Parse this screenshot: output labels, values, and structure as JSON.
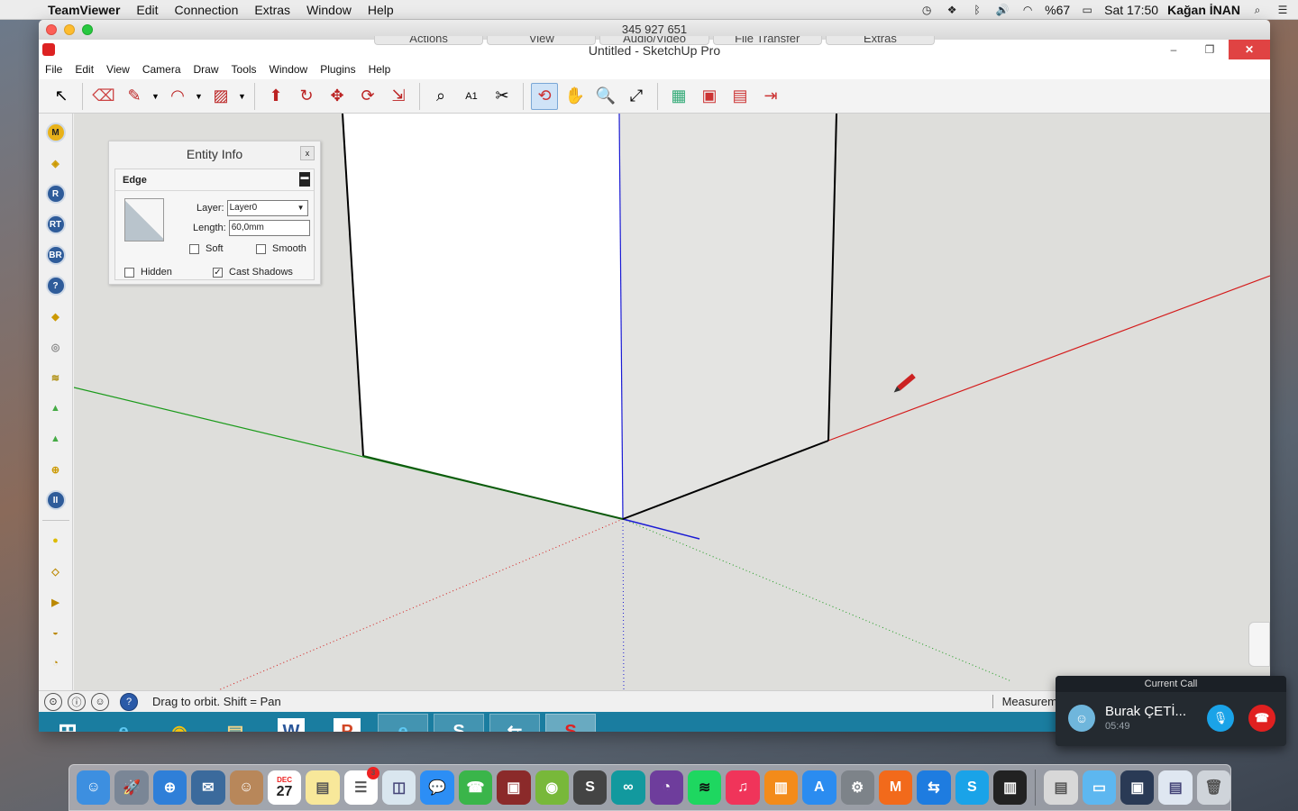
{
  "mac_menubar": {
    "app_name": "TeamViewer",
    "items": [
      "Edit",
      "Connection",
      "Extras",
      "Window",
      "Help"
    ],
    "battery": "%67",
    "clock": "Sat 17:50",
    "user": "Kağan İNAN"
  },
  "teamviewer": {
    "session_id": "345 927 651",
    "tabs": [
      "Actions",
      "View",
      "Audio/Video",
      "File Transfer",
      "Extras"
    ]
  },
  "sketchup": {
    "title": "Untitled - SketchUp Pro",
    "menu": [
      "File",
      "Edit",
      "View",
      "Camera",
      "Draw",
      "Tools",
      "Window",
      "Plugins",
      "Help"
    ],
    "toolbar_glyphs": [
      "↖",
      "⌫",
      "✎",
      "◠",
      "▨",
      "⬆",
      "↻",
      "✥",
      "⟳",
      "⇲",
      "⌕",
      "A1",
      "✂",
      "⟲",
      "✋",
      "🔍",
      "⤢",
      "▦",
      "▣",
      "▤",
      "⇥"
    ],
    "left_tools": [
      "M",
      "◈",
      "R",
      "RT",
      "BR",
      "?",
      "◆",
      "◎",
      "≋",
      "▲",
      "▲",
      "⊕",
      "II",
      "●",
      "◇",
      "▶",
      "◒",
      "◔"
    ],
    "status_text": "Drag to orbit.  Shift = Pan",
    "measure_label": "Measurem"
  },
  "entity_info": {
    "title": "Entity Info",
    "close": "x",
    "type": "Edge",
    "layer_label": "Layer:",
    "layer_value": "Layer0",
    "length_label": "Length:",
    "length_value": "60,0mm",
    "soft_label": "Soft",
    "smooth_label": "Smooth",
    "hidden_label": "Hidden",
    "cast_shadows_label": "Cast Shadows",
    "soft_checked": false,
    "smooth_checked": false,
    "hidden_checked": false,
    "cast_shadows_checked": true
  },
  "call": {
    "header": "Current Call",
    "name": "Burak ÇETİ...",
    "duration": "05:49"
  },
  "dock": {
    "reminders_badge": "3",
    "calendar_month": "DEC",
    "calendar_day": "27"
  },
  "colors": {
    "axis_red": "#d41a1a",
    "axis_green": "#1a9a1a",
    "axis_blue": "#1a1ad4",
    "taskbar": "#1a7da0"
  }
}
